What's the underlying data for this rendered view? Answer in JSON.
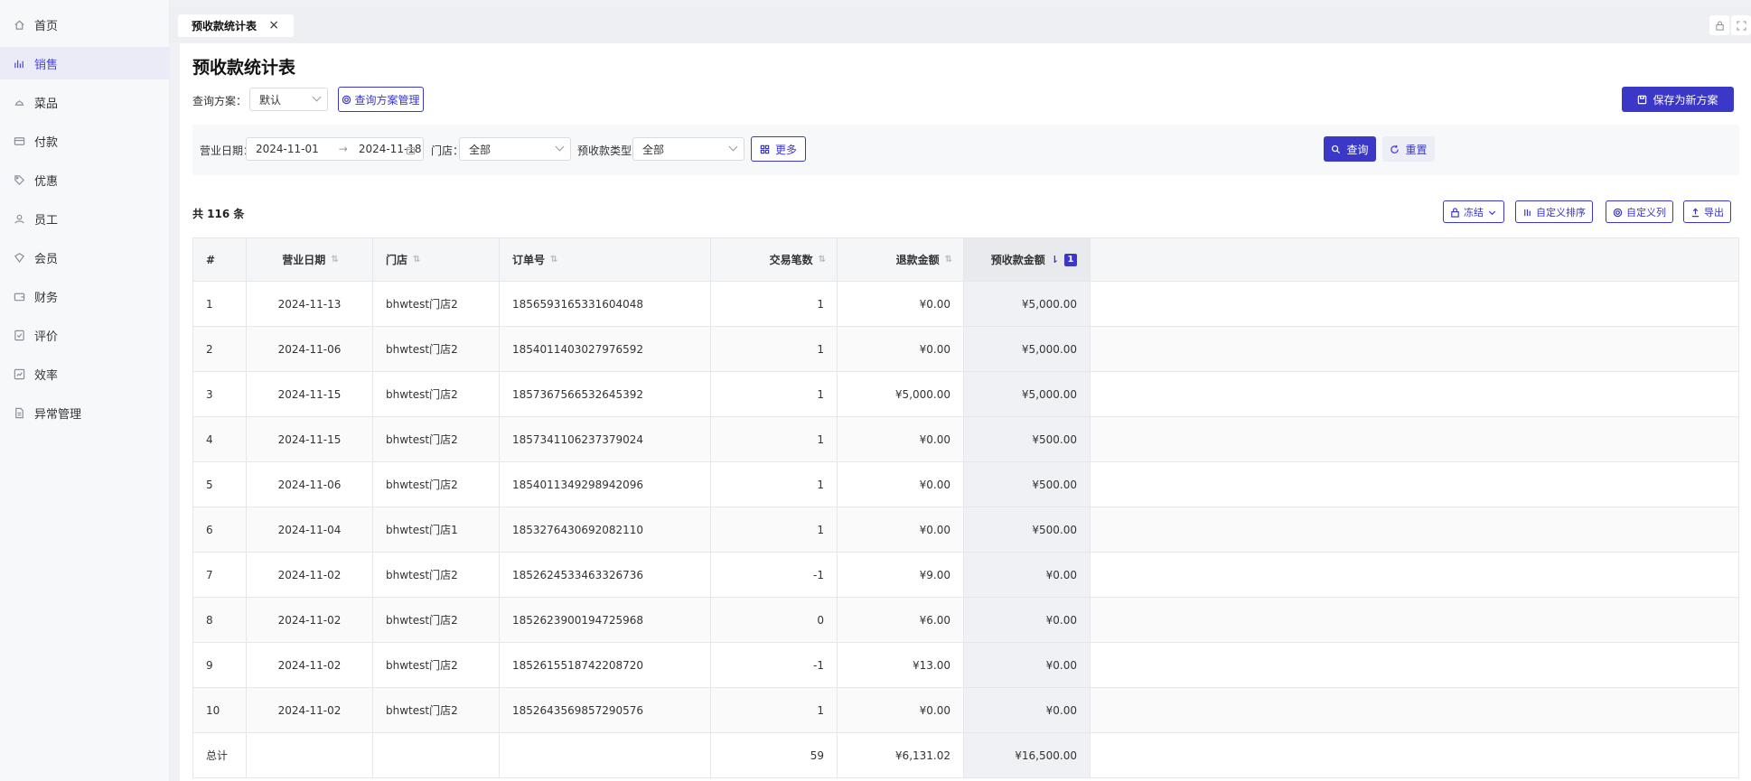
{
  "sidebar": {
    "items": [
      {
        "label": "首页",
        "icon": "home-icon",
        "active": false
      },
      {
        "label": "销售",
        "icon": "bar-chart-icon",
        "active": true
      },
      {
        "label": "菜品",
        "icon": "dish-icon",
        "active": false
      },
      {
        "label": "付款",
        "icon": "card-icon",
        "active": false
      },
      {
        "label": "优惠",
        "icon": "tag-icon",
        "active": false
      },
      {
        "label": "员工",
        "icon": "user-icon",
        "active": false
      },
      {
        "label": "会员",
        "icon": "member-icon",
        "active": false
      },
      {
        "label": "财务",
        "icon": "wallet-icon",
        "active": false
      },
      {
        "label": "评价",
        "icon": "review-icon",
        "active": false
      },
      {
        "label": "效率",
        "icon": "efficiency-icon",
        "active": false
      },
      {
        "label": "异常管理",
        "icon": "document-icon",
        "active": false
      }
    ]
  },
  "tabs": [
    {
      "label": "预收款统计表",
      "close": "×"
    }
  ],
  "page": {
    "title": "预收款统计表"
  },
  "scheme": {
    "label": "查询方案：",
    "value": "默认",
    "manage_label": "查询方案管理",
    "save_label": "保存为新方案"
  },
  "filters": {
    "date_label": "营业日期：",
    "date_start": "2024-11-01",
    "date_sep": "→",
    "date_end": "2024-11-18",
    "store_label": "门店：",
    "store_value": "全部",
    "type_label": "预收款类型：",
    "type_value": "全部",
    "more_label": "更多",
    "query_label": "查询",
    "reset_label": "重置"
  },
  "summary": {
    "total_text": "共 116 条"
  },
  "toolbar": {
    "freeze_label": "冻结",
    "sort_label": "自定义排序",
    "columns_label": "自定义列",
    "export_label": "导出"
  },
  "table": {
    "headers": [
      "#",
      "营业日期",
      "门店",
      "订单号",
      "交易笔数",
      "退款金额",
      "预收款金额"
    ],
    "sort_badge": "1",
    "rows": [
      [
        "1",
        "2024-11-13",
        "bhwtest门店2",
        "1856593165331604048",
        "1",
        "¥0.00",
        "¥5,000.00"
      ],
      [
        "2",
        "2024-11-06",
        "bhwtest门店2",
        "1854011403027976592",
        "1",
        "¥0.00",
        "¥5,000.00"
      ],
      [
        "3",
        "2024-11-15",
        "bhwtest门店2",
        "1857367566532645392",
        "1",
        "¥5,000.00",
        "¥5,000.00"
      ],
      [
        "4",
        "2024-11-15",
        "bhwtest门店2",
        "1857341106237379024",
        "1",
        "¥0.00",
        "¥500.00"
      ],
      [
        "5",
        "2024-11-06",
        "bhwtest门店2",
        "1854011349298942096",
        "1",
        "¥0.00",
        "¥500.00"
      ],
      [
        "6",
        "2024-11-04",
        "bhwtest门店1",
        "1853276430692082110",
        "1",
        "¥0.00",
        "¥500.00"
      ],
      [
        "7",
        "2024-11-02",
        "bhwtest门店2",
        "1852624533463326736",
        "-1",
        "¥9.00",
        "¥0.00"
      ],
      [
        "8",
        "2024-11-02",
        "bhwtest门店2",
        "1852623900194725968",
        "0",
        "¥6.00",
        "¥0.00"
      ],
      [
        "9",
        "2024-11-02",
        "bhwtest门店2",
        "1852615518742208720",
        "-1",
        "¥13.00",
        "¥0.00"
      ],
      [
        "10",
        "2024-11-02",
        "bhwtest门店2",
        "1852643569857290576",
        "1",
        "¥0.00",
        "¥0.00"
      ]
    ],
    "totals": [
      "总计",
      "",
      "",
      "",
      "59",
      "¥6,131.02",
      "¥16,500.00"
    ]
  },
  "colors": {
    "accent": "#3b37c7",
    "active_nav_bg": "#ebebf8"
  }
}
